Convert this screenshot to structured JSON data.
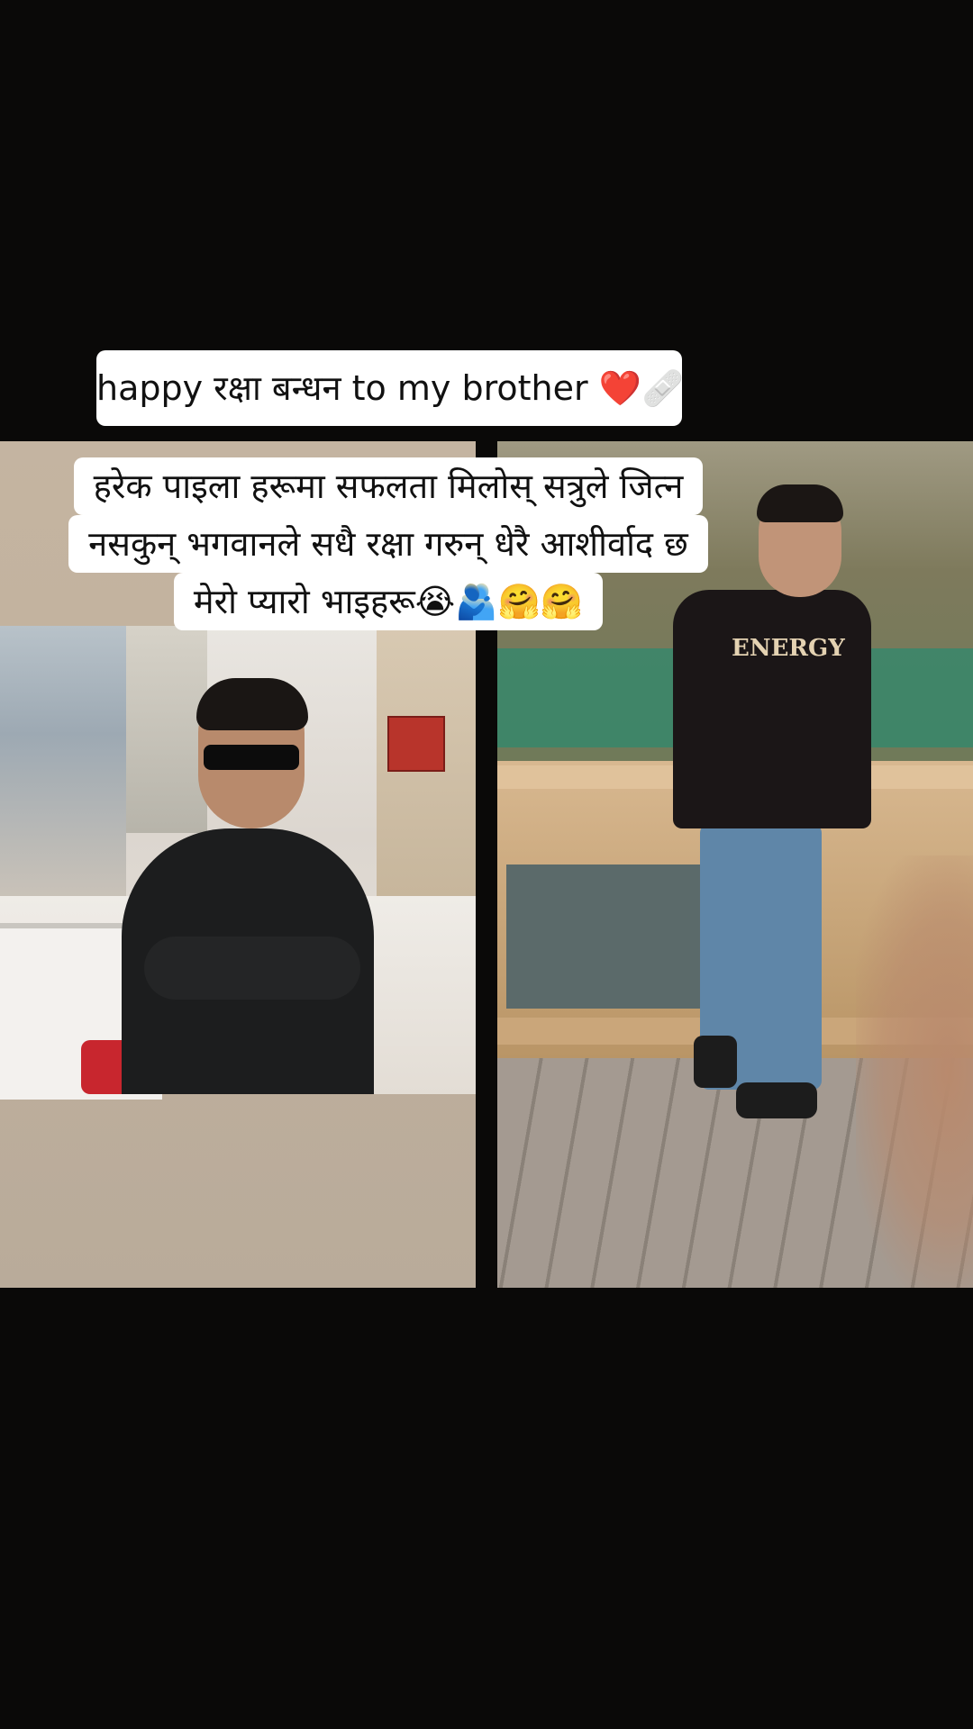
{
  "captions": {
    "title": "happy रक्षा बन्धन to my brother ❤️🩹",
    "message_lines": [
      "हरेक पाइला हरूमा सफलता मिलोस् सत्रुले जित्न",
      "नसकुन् भगवानले सधै रक्षा गरुन् धेरै आशीर्वाद छ",
      "मेरो प्यारो भाइहरू😭🫂🤗🤗"
    ]
  },
  "photos": {
    "right_shirt_print": "ENERGY"
  }
}
